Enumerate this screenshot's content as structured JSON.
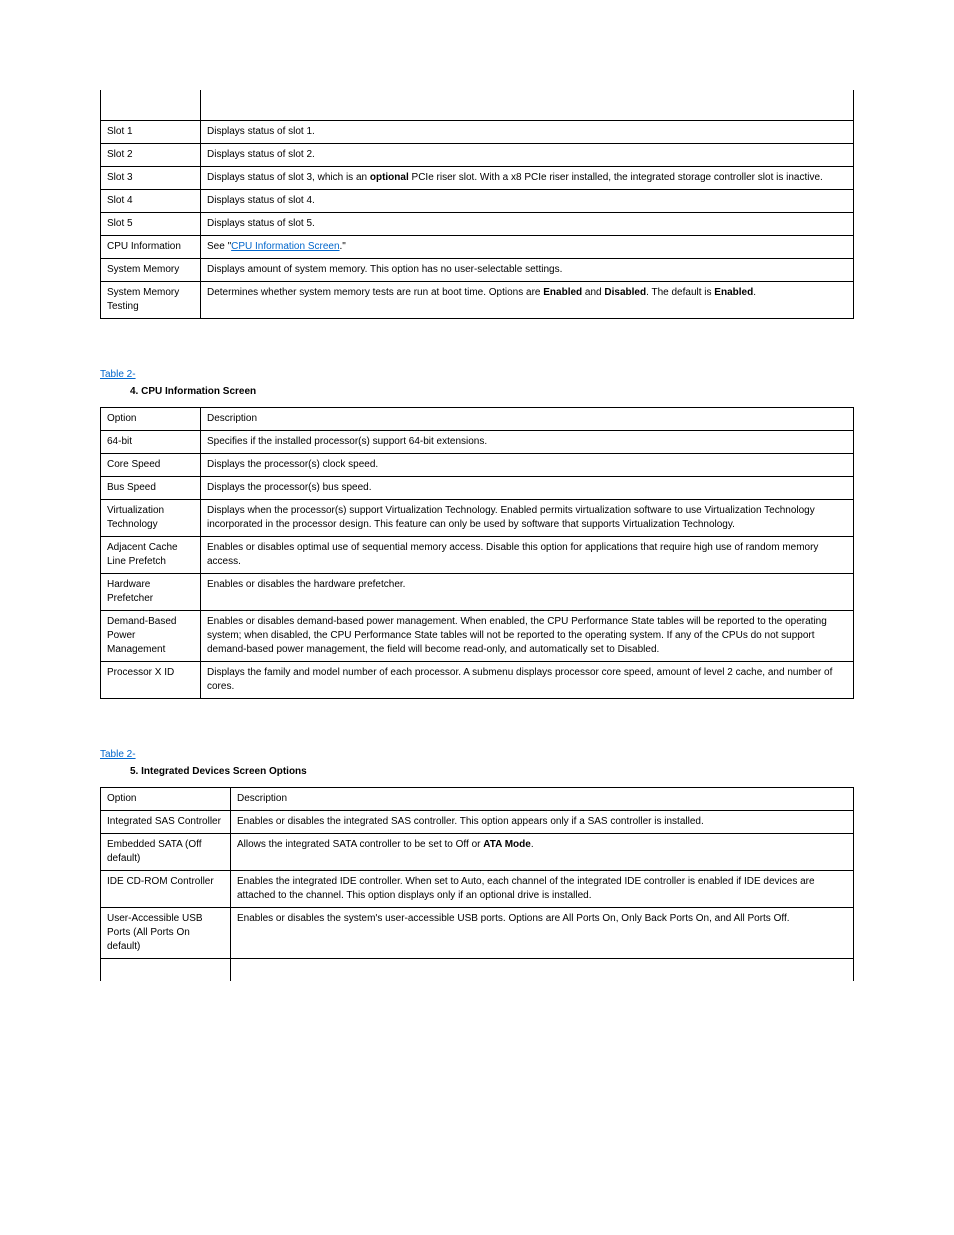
{
  "table3": {
    "rows": [
      {
        "opt": "Slot 1",
        "desc": "Displays status of slot 1."
      },
      {
        "opt": "Slot 2",
        "desc": "Displays status of slot 2."
      },
      {
        "opt": "Slot 3",
        "desc_pre": "Displays status of slot 3, which is an ",
        "desc_bold": "optional",
        "desc_post": " PCIe riser slot. With a x8 PCIe riser installed, the integrated storage controller slot is inactive."
      },
      {
        "opt": "Slot 4",
        "desc": "Displays status of slot 4."
      },
      {
        "opt": "Slot 5",
        "desc": "Displays status of slot 5."
      },
      {
        "opt": "CPU Information",
        "desc_pre": "See \"",
        "link": "CPU Information Screen",
        "desc_post": ".\""
      },
      {
        "opt": "System Memory",
        "desc": "Displays amount of system memory. This option has no user-selectable settings."
      },
      {
        "opt": "System Memory Testing",
        "desc_pre": "Determines whether system memory tests are run at boot time. Options are ",
        "desc_bold": "Enabled",
        "desc_post": " and ",
        "desc_bold2": "Disabled",
        "desc_post2": ". The default is ",
        "desc_bold3": "Enabled",
        "desc_post3": "."
      }
    ]
  },
  "section4": {
    "label_link": "Table 2-",
    "caption": "4. CPU Information Screen",
    "rows": [
      {
        "opt": "Option",
        "desc": "Description"
      },
      {
        "opt": "64-bit",
        "desc": "Specifies if the installed processor(s) support 64-bit extensions."
      },
      {
        "opt": "Core Speed",
        "desc": "Displays the processor(s) clock speed."
      },
      {
        "opt": "Bus Speed",
        "desc": "Displays the processor(s) bus speed."
      },
      {
        "opt": "Virtualization Technology",
        "desc": "Displays when the processor(s) support Virtualization Technology. Enabled permits virtualization software to use Virtualization Technology incorporated in the processor design. This feature can only be used by software that supports Virtualization Technology."
      },
      {
        "opt": "Adjacent Cache Line Prefetch",
        "desc": "Enables or disables optimal use of sequential memory access. Disable this option for applications that require high use of random memory access."
      },
      {
        "opt": "Hardware Prefetcher",
        "desc": "Enables or disables the hardware prefetcher."
      },
      {
        "opt": "Demand-Based Power Management",
        "desc": "Enables or disables demand-based power management. When enabled, the CPU Performance State tables will be reported to the operating system; when disabled, the CPU Performance State tables will not be reported to the operating system. If any of the CPUs do not support demand-based power management, the field will become read-only, and automatically set to Disabled."
      },
      {
        "opt": "Processor X ID",
        "desc": "Displays the family and model number of each processor. A submenu displays processor core speed, amount of level 2 cache, and number of cores."
      }
    ]
  },
  "section5": {
    "label_link": "Table 2-",
    "caption": "5. Integrated Devices Screen Options",
    "rows": [
      {
        "opt": "Option",
        "desc": "Description"
      },
      {
        "opt": "Integrated SAS Controller",
        "desc": "Enables or disables the integrated SAS controller. This option appears only if a SAS controller is installed."
      },
      {
        "opt": "Embedded SATA (Off default)",
        "desc_pre": "Allows the integrated SATA controller to be set to Off or ",
        "desc_bold": "ATA Mode",
        "desc_post": "."
      },
      {
        "opt": "IDE CD-ROM Controller",
        "desc": "Enables the integrated IDE controller. When set to Auto, each channel of the integrated IDE controller is enabled if IDE devices are attached to the channel. This option displays only if an optional drive is installed."
      },
      {
        "opt": "User-Accessible USB Ports (All Ports On default)",
        "desc": "Enables or disables the system's user-accessible USB ports. Options are All Ports On, Only Back Ports On, and All Ports Off."
      }
    ]
  }
}
